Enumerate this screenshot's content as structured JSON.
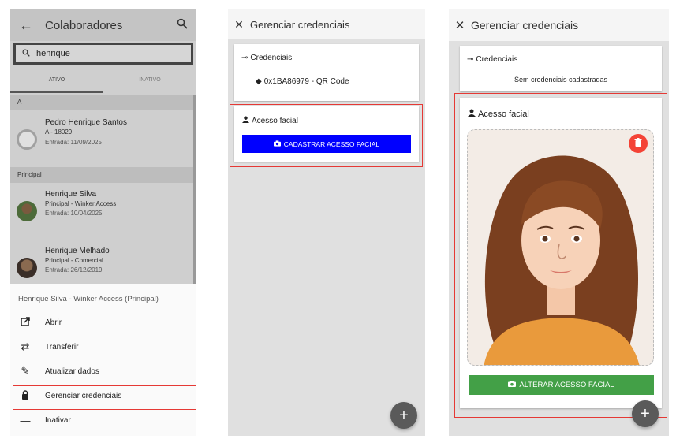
{
  "panel1": {
    "header": {
      "title": "Colaboradores",
      "back_icon": "arrow-left-icon",
      "search_icon": "search-icon"
    },
    "search": {
      "value": "henrique"
    },
    "tabs": [
      {
        "label": "ATIVO"
      },
      {
        "label": "INATIVO"
      }
    ],
    "sections": [
      {
        "header": "A",
        "people": [
          {
            "name": "Pedro Henrique Santos",
            "sub": "A - 18029",
            "date": "Entrada: 11/09/2025"
          }
        ]
      },
      {
        "header": "Principal",
        "people": [
          {
            "name": "Henrique Silva",
            "sub": "Principal - Winker Access",
            "date": "Entrada: 10/04/2025"
          },
          {
            "name": "Henrique Melhado",
            "sub": "Principal - Comercial",
            "date": "Entrada: 26/12/2019"
          }
        ]
      }
    ],
    "sheet": {
      "title": "Henrique Silva - Winker Access (Principal)",
      "items": [
        {
          "label": "Abrir",
          "icon": "open-in-new-icon"
        },
        {
          "label": "Transferir",
          "icon": "swap-icon"
        },
        {
          "label": "Atualizar dados",
          "icon": "pencil-icon"
        },
        {
          "label": "Gerenciar credenciais",
          "icon": "lock-icon"
        },
        {
          "label": "Inativar",
          "icon": "minus-icon"
        }
      ]
    }
  },
  "panel2": {
    "header": {
      "title": "Gerenciar credenciais"
    },
    "credentials_card": {
      "title": "Credenciais",
      "item": "0x1BA86979 - QR Code"
    },
    "face_card": {
      "title": "Acesso facial",
      "button": "CADASTRAR ACESSO FACIAL"
    },
    "fab": "+"
  },
  "panel3": {
    "header": {
      "title": "Gerenciar credenciais"
    },
    "credentials_card": {
      "title": "Credenciais",
      "empty": "Sem credenciais cadastradas"
    },
    "face_card": {
      "title": "Acesso facial",
      "button": "ALTERAR ACESSO FACIAL"
    },
    "fab": "+"
  },
  "colors": {
    "primary_blue": "#0000ff",
    "success_green": "#43a047",
    "danger_red": "#f44336",
    "highlight_red": "#e53935"
  }
}
